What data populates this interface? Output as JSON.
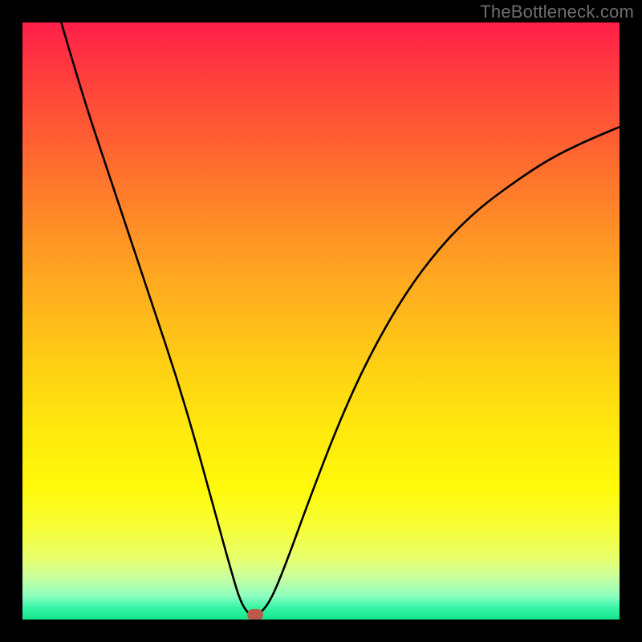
{
  "watermark_text": "TheBottleneck.com",
  "chart_data": {
    "type": "line",
    "title": "",
    "xlabel": "",
    "ylabel": "",
    "xlim": [
      0,
      100
    ],
    "ylim": [
      0,
      100
    ],
    "grid": false,
    "legend": false,
    "curve": {
      "description": "V-shaped bottleneck curve (lower is better)",
      "points": [
        {
          "x": 6.5,
          "y": 100.0
        },
        {
          "x": 10.0,
          "y": 88.0
        },
        {
          "x": 14.0,
          "y": 76.0
        },
        {
          "x": 18.0,
          "y": 64.0
        },
        {
          "x": 22.0,
          "y": 52.0
        },
        {
          "x": 26.0,
          "y": 40.0
        },
        {
          "x": 29.5,
          "y": 28.0
        },
        {
          "x": 32.5,
          "y": 17.0
        },
        {
          "x": 35.0,
          "y": 8.0
        },
        {
          "x": 36.5,
          "y": 3.0
        },
        {
          "x": 38.0,
          "y": 0.7
        },
        {
          "x": 39.5,
          "y": 0.7
        },
        {
          "x": 41.5,
          "y": 3.0
        },
        {
          "x": 44.0,
          "y": 9.0
        },
        {
          "x": 48.0,
          "y": 20.0
        },
        {
          "x": 53.0,
          "y": 33.0
        },
        {
          "x": 58.0,
          "y": 44.0
        },
        {
          "x": 64.0,
          "y": 54.5
        },
        {
          "x": 70.0,
          "y": 62.5
        },
        {
          "x": 76.0,
          "y": 68.5
        },
        {
          "x": 82.0,
          "y": 73.0
        },
        {
          "x": 88.0,
          "y": 77.0
        },
        {
          "x": 94.0,
          "y": 80.0
        },
        {
          "x": 100.0,
          "y": 82.5
        }
      ]
    },
    "marker": {
      "x": 39.0,
      "y": 0.8,
      "color": "#bb5a4b"
    },
    "background_gradient": {
      "top": "#ff1f4a",
      "mid": "#ffe80e",
      "bottom": "#14e58a"
    }
  }
}
